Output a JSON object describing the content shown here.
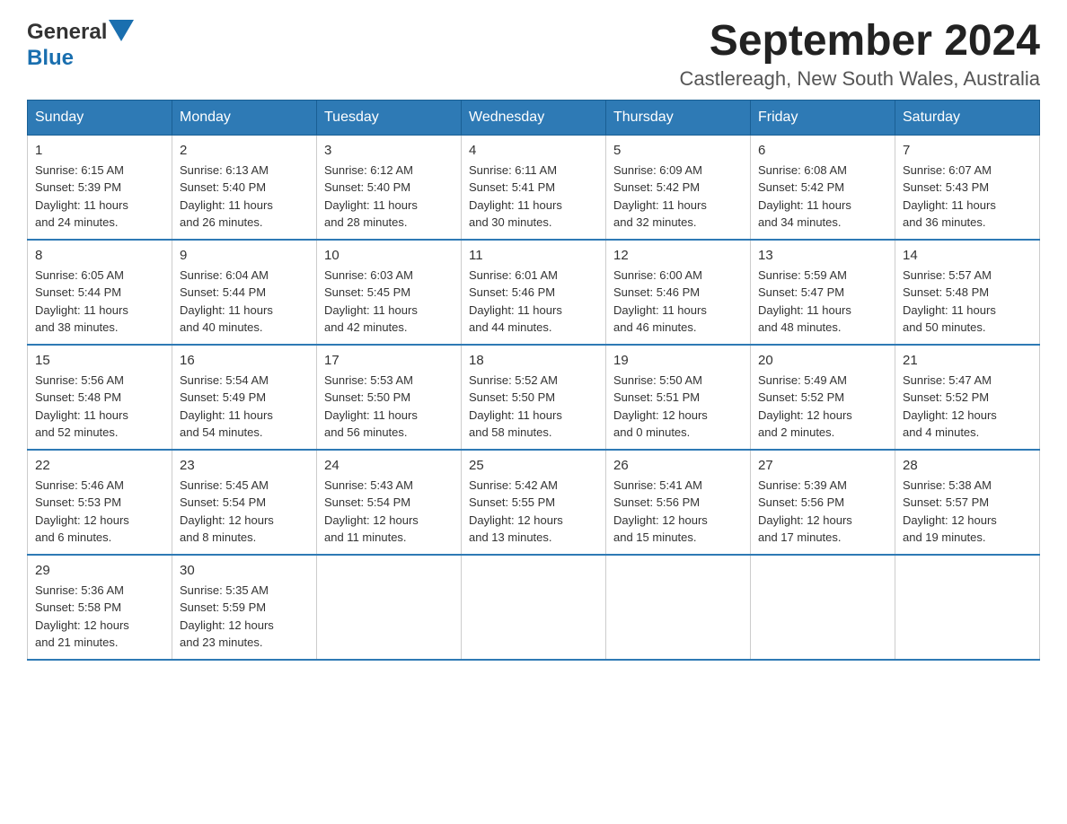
{
  "logo": {
    "general": "General",
    "blue": "Blue"
  },
  "title": "September 2024",
  "location": "Castlereagh, New South Wales, Australia",
  "weekdays": [
    "Sunday",
    "Monday",
    "Tuesday",
    "Wednesday",
    "Thursday",
    "Friday",
    "Saturday"
  ],
  "weeks": [
    [
      {
        "day": "1",
        "sunrise": "6:15 AM",
        "sunset": "5:39 PM",
        "daylight": "11 hours and 24 minutes."
      },
      {
        "day": "2",
        "sunrise": "6:13 AM",
        "sunset": "5:40 PM",
        "daylight": "11 hours and 26 minutes."
      },
      {
        "day": "3",
        "sunrise": "6:12 AM",
        "sunset": "5:40 PM",
        "daylight": "11 hours and 28 minutes."
      },
      {
        "day": "4",
        "sunrise": "6:11 AM",
        "sunset": "5:41 PM",
        "daylight": "11 hours and 30 minutes."
      },
      {
        "day": "5",
        "sunrise": "6:09 AM",
        "sunset": "5:42 PM",
        "daylight": "11 hours and 32 minutes."
      },
      {
        "day": "6",
        "sunrise": "6:08 AM",
        "sunset": "5:42 PM",
        "daylight": "11 hours and 34 minutes."
      },
      {
        "day": "7",
        "sunrise": "6:07 AM",
        "sunset": "5:43 PM",
        "daylight": "11 hours and 36 minutes."
      }
    ],
    [
      {
        "day": "8",
        "sunrise": "6:05 AM",
        "sunset": "5:44 PM",
        "daylight": "11 hours and 38 minutes."
      },
      {
        "day": "9",
        "sunrise": "6:04 AM",
        "sunset": "5:44 PM",
        "daylight": "11 hours and 40 minutes."
      },
      {
        "day": "10",
        "sunrise": "6:03 AM",
        "sunset": "5:45 PM",
        "daylight": "11 hours and 42 minutes."
      },
      {
        "day": "11",
        "sunrise": "6:01 AM",
        "sunset": "5:46 PM",
        "daylight": "11 hours and 44 minutes."
      },
      {
        "day": "12",
        "sunrise": "6:00 AM",
        "sunset": "5:46 PM",
        "daylight": "11 hours and 46 minutes."
      },
      {
        "day": "13",
        "sunrise": "5:59 AM",
        "sunset": "5:47 PM",
        "daylight": "11 hours and 48 minutes."
      },
      {
        "day": "14",
        "sunrise": "5:57 AM",
        "sunset": "5:48 PM",
        "daylight": "11 hours and 50 minutes."
      }
    ],
    [
      {
        "day": "15",
        "sunrise": "5:56 AM",
        "sunset": "5:48 PM",
        "daylight": "11 hours and 52 minutes."
      },
      {
        "day": "16",
        "sunrise": "5:54 AM",
        "sunset": "5:49 PM",
        "daylight": "11 hours and 54 minutes."
      },
      {
        "day": "17",
        "sunrise": "5:53 AM",
        "sunset": "5:50 PM",
        "daylight": "11 hours and 56 minutes."
      },
      {
        "day": "18",
        "sunrise": "5:52 AM",
        "sunset": "5:50 PM",
        "daylight": "11 hours and 58 minutes."
      },
      {
        "day": "19",
        "sunrise": "5:50 AM",
        "sunset": "5:51 PM",
        "daylight": "12 hours and 0 minutes."
      },
      {
        "day": "20",
        "sunrise": "5:49 AM",
        "sunset": "5:52 PM",
        "daylight": "12 hours and 2 minutes."
      },
      {
        "day": "21",
        "sunrise": "5:47 AM",
        "sunset": "5:52 PM",
        "daylight": "12 hours and 4 minutes."
      }
    ],
    [
      {
        "day": "22",
        "sunrise": "5:46 AM",
        "sunset": "5:53 PM",
        "daylight": "12 hours and 6 minutes."
      },
      {
        "day": "23",
        "sunrise": "5:45 AM",
        "sunset": "5:54 PM",
        "daylight": "12 hours and 8 minutes."
      },
      {
        "day": "24",
        "sunrise": "5:43 AM",
        "sunset": "5:54 PM",
        "daylight": "12 hours and 11 minutes."
      },
      {
        "day": "25",
        "sunrise": "5:42 AM",
        "sunset": "5:55 PM",
        "daylight": "12 hours and 13 minutes."
      },
      {
        "day": "26",
        "sunrise": "5:41 AM",
        "sunset": "5:56 PM",
        "daylight": "12 hours and 15 minutes."
      },
      {
        "day": "27",
        "sunrise": "5:39 AM",
        "sunset": "5:56 PM",
        "daylight": "12 hours and 17 minutes."
      },
      {
        "day": "28",
        "sunrise": "5:38 AM",
        "sunset": "5:57 PM",
        "daylight": "12 hours and 19 minutes."
      }
    ],
    [
      {
        "day": "29",
        "sunrise": "5:36 AM",
        "sunset": "5:58 PM",
        "daylight": "12 hours and 21 minutes."
      },
      {
        "day": "30",
        "sunrise": "5:35 AM",
        "sunset": "5:59 PM",
        "daylight": "12 hours and 23 minutes."
      },
      null,
      null,
      null,
      null,
      null
    ]
  ],
  "labels": {
    "sunrise": "Sunrise:",
    "sunset": "Sunset:",
    "daylight": "Daylight:"
  }
}
